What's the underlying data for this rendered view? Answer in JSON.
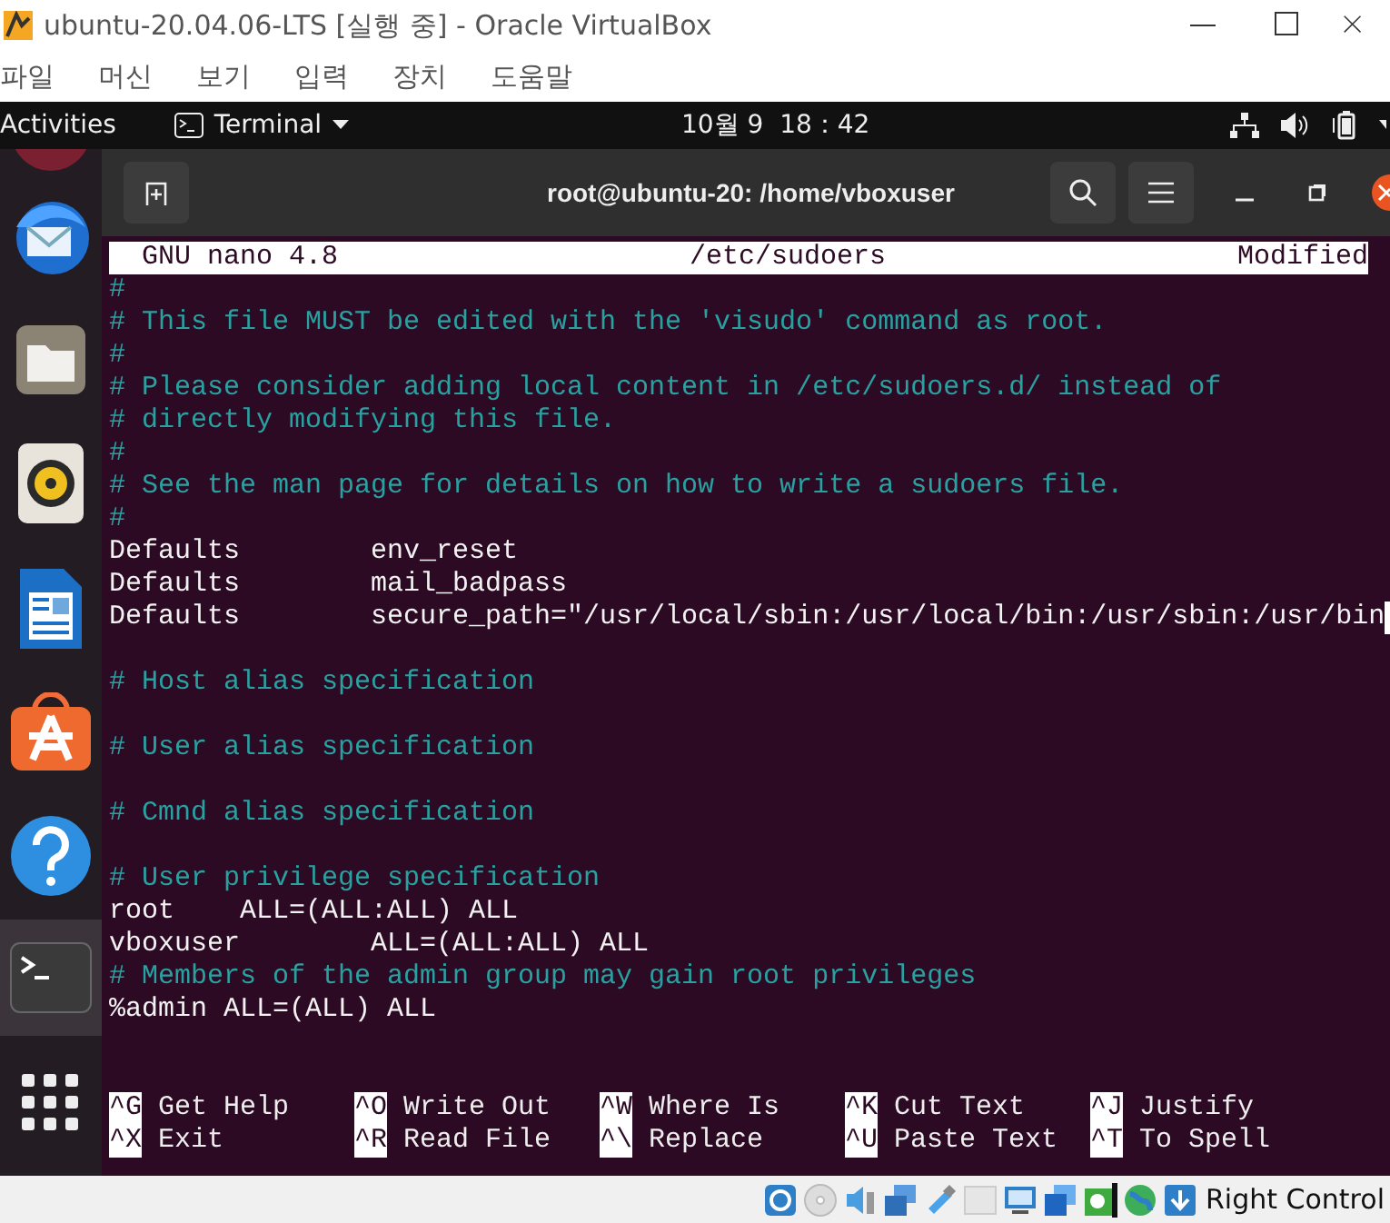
{
  "window": {
    "title": "ubuntu-20.04.06-LTS [실행 중] - Oracle VirtualBox"
  },
  "menu": [
    "파일",
    "머신",
    "보기",
    "입력",
    "장치",
    "도움말"
  ],
  "top_panel": {
    "activities": "Activities",
    "app_menu": "Terminal",
    "clock": "10월 9  18：42"
  },
  "dock": [
    {
      "kind": "partial",
      "selected": false
    },
    {
      "kind": "mail",
      "selected": false
    },
    {
      "kind": "files",
      "selected": false
    },
    {
      "kind": "audio",
      "selected": false
    },
    {
      "kind": "writer",
      "selected": false
    },
    {
      "kind": "store",
      "selected": false
    },
    {
      "kind": "help",
      "selected": false
    },
    {
      "kind": "terminal",
      "selected": true
    }
  ],
  "terminal": {
    "title": "root@ubuntu-20: /home/vboxuser",
    "nano": {
      "version": "GNU nano 4.8",
      "filename": "/etc/sudoers",
      "status": "Modified"
    },
    "lines": [
      {
        "kind": "comment",
        "text": "#"
      },
      {
        "kind": "comment",
        "text": "# This file MUST be edited with the 'visudo' command as root."
      },
      {
        "kind": "comment",
        "text": "#"
      },
      {
        "kind": "comment",
        "text": "# Please consider adding local content in /etc/sudoers.d/ instead of"
      },
      {
        "kind": "comment",
        "text": "# directly modifying this file."
      },
      {
        "kind": "comment",
        "text": "#"
      },
      {
        "kind": "comment",
        "text": "# See the man page for details on how to write a sudoers file."
      },
      {
        "kind": "comment",
        "text": "#"
      },
      {
        "kind": "code",
        "text": "Defaults        env_reset"
      },
      {
        "kind": "code",
        "text": "Defaults        mail_badpass"
      },
      {
        "kind": "code",
        "text": "Defaults        secure_path=\"/usr/local/sbin:/usr/local/bin:/usr/sbin:/usr/bin",
        "cursor": true
      },
      {
        "kind": "blank"
      },
      {
        "kind": "comment",
        "text": "# Host alias specification"
      },
      {
        "kind": "blank"
      },
      {
        "kind": "comment",
        "text": "# User alias specification"
      },
      {
        "kind": "blank"
      },
      {
        "kind": "comment",
        "text": "# Cmnd alias specification"
      },
      {
        "kind": "blank"
      },
      {
        "kind": "comment",
        "text": "# User privilege specification"
      },
      {
        "kind": "code",
        "text": "root    ALL=(ALL:ALL) ALL"
      },
      {
        "kind": "code",
        "text": "vboxuser        ALL=(ALL:ALL) ALL"
      },
      {
        "kind": "comment",
        "text": "# Members of the admin group may gain root privileges"
      },
      {
        "kind": "code",
        "text": "%admin ALL=(ALL) ALL"
      }
    ],
    "shortcuts": [
      {
        "key": "^G",
        "label": "Get Help"
      },
      {
        "key": "^X",
        "label": "Exit"
      },
      {
        "key": "^O",
        "label": "Write Out"
      },
      {
        "key": "^R",
        "label": "Read File"
      },
      {
        "key": "^W",
        "label": "Where Is"
      },
      {
        "key": "^\\",
        "label": "Replace"
      },
      {
        "key": "^K",
        "label": "Cut Text"
      },
      {
        "key": "^U",
        "label": "Paste Text"
      },
      {
        "key": "^J",
        "label": "Justify"
      },
      {
        "key": "^T",
        "label": "To Spell"
      }
    ]
  },
  "status_bar": {
    "host_key": "Right Control"
  }
}
